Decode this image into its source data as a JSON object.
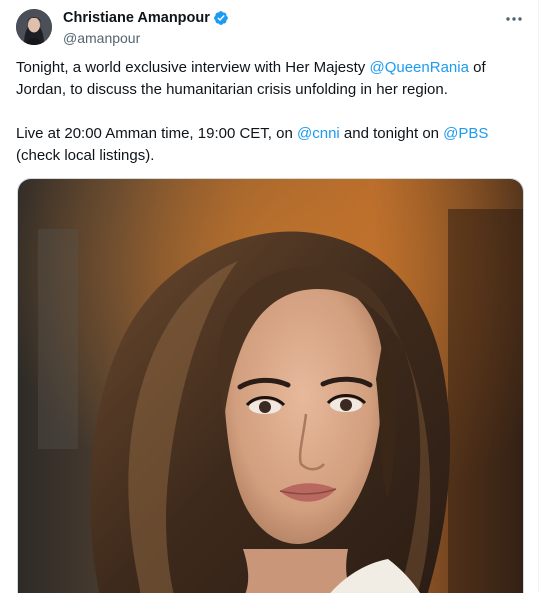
{
  "author": {
    "display_name": "Christiane Amanpour",
    "handle": "@amanpour",
    "verified": true,
    "avatar": "avatar"
  },
  "menu_icon": "more-horizontal-icon",
  "tweet": {
    "p1_before": "Tonight, a world exclusive interview with Her Majesty ",
    "p1_mention": "@QueenRania",
    "p1_after": " of Jordan, to discuss the humanitarian crisis unfolding in her region.",
    "p2_before": "Live at 20:00 Amman time, 19:00 CET, on ",
    "p2_mention1": "@cnni",
    "p2_middle": " and tonight on ",
    "p2_mention2": "@PBS",
    "p2_after": " (check local listings)."
  },
  "media": {
    "type": "photo"
  },
  "colors": {
    "link": "#1d9bf0",
    "verified": "#1d9bf0",
    "text": "#0f1419",
    "secondary": "#536471"
  }
}
